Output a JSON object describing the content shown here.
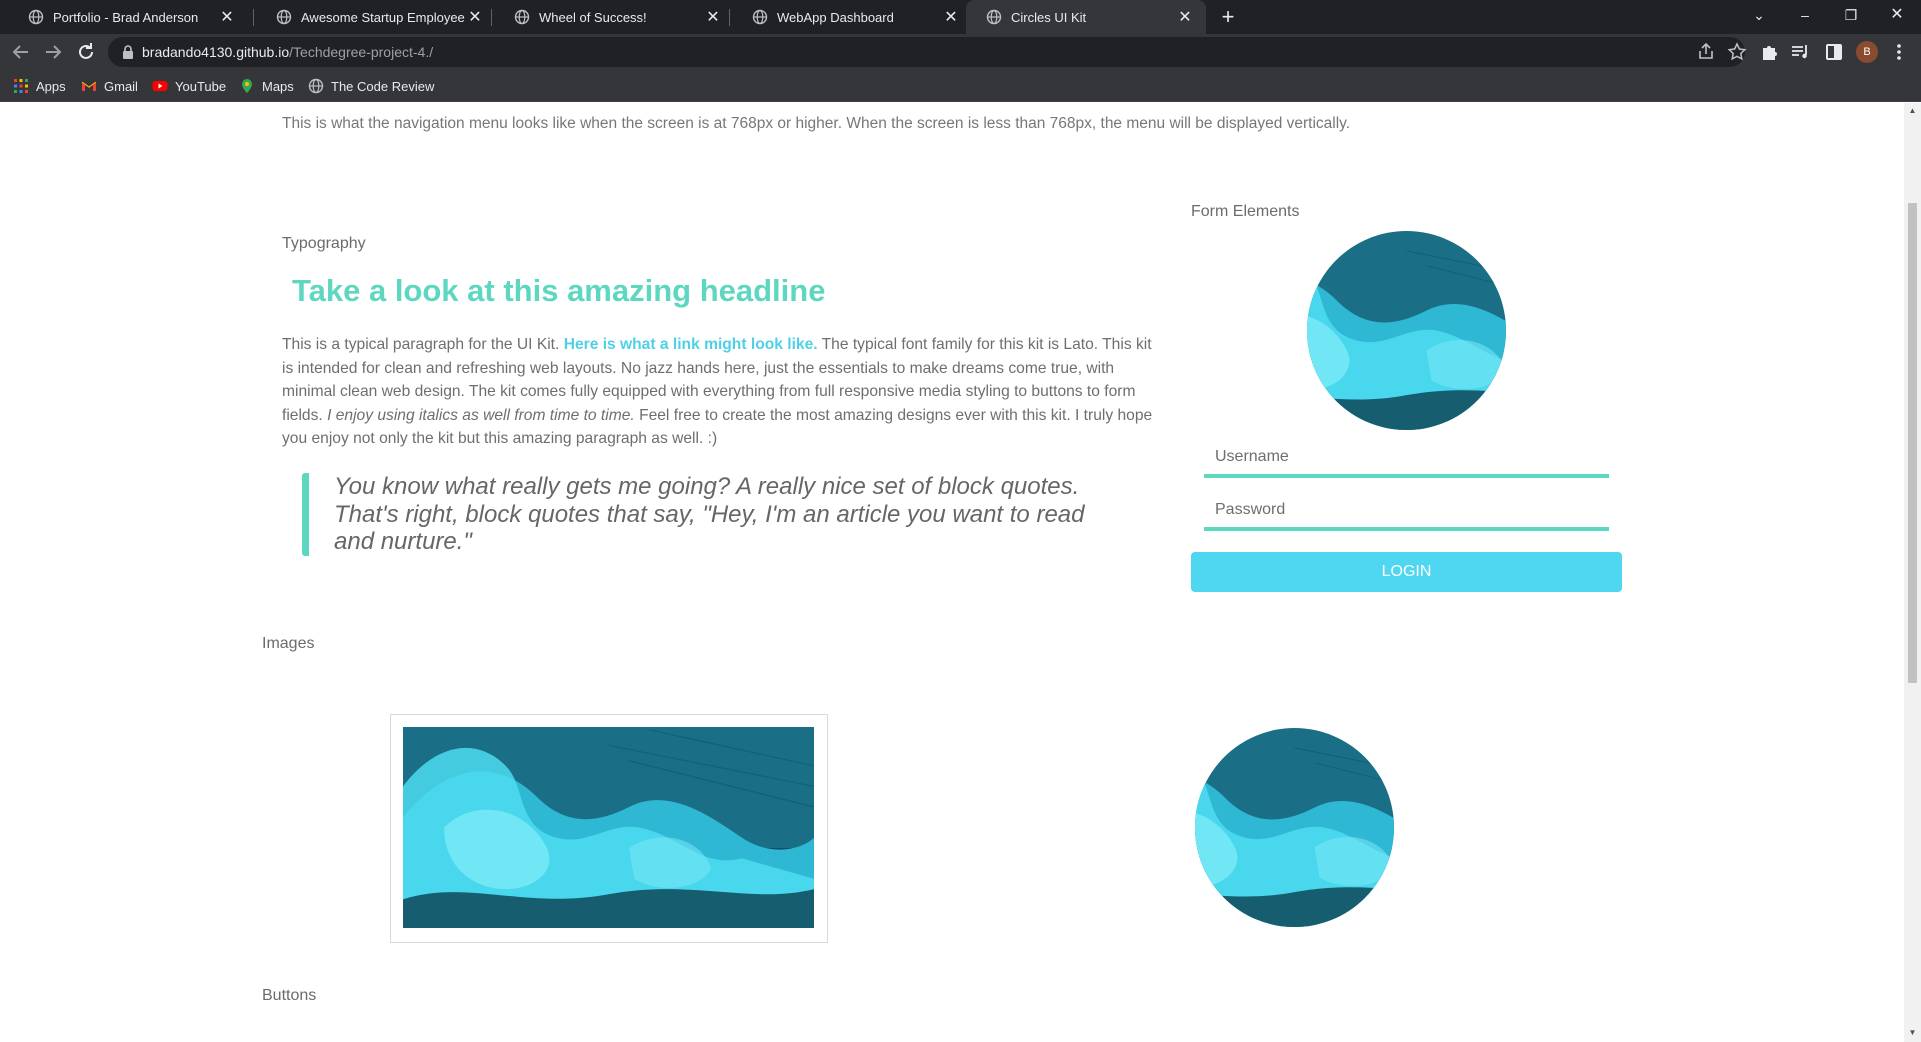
{
  "browser": {
    "tabs": [
      {
        "title": "Portfolio - Brad Anderson",
        "active": false
      },
      {
        "title": "Awesome Startup Employee Dire",
        "active": false
      },
      {
        "title": "Wheel of Success!",
        "active": false
      },
      {
        "title": "WebApp Dashboard",
        "active": false
      },
      {
        "title": "Circles UI Kit",
        "active": true
      }
    ],
    "url_host": "bradando4130.github.io",
    "url_path": "/Techdegree-project-4./",
    "profile_initial": "B",
    "bookmarks": [
      "Apps",
      "Gmail",
      "YouTube",
      "Maps",
      "The Code Review"
    ]
  },
  "page": {
    "nav_note": "This is what the navigation menu looks like when the screen is at 768px or higher. When the screen is less than 768px, the menu will be displayed vertically.",
    "typography": {
      "label": "Typography",
      "headline": "Take a look at this amazing headline",
      "para_part1": "This is a typical paragraph for the UI Kit. ",
      "para_link": "Here is what a link might look like.",
      "para_part2": " The typical font family for this kit is Lato. This kit is intended for clean and refreshing web layouts. No jazz hands here, just the essentials to make dreams come true, with minimal clean web design. The kit comes fully equipped with everything from full responsive media styling to buttons to form fields. ",
      "para_italic": "I enjoy using italics as well from time to time.",
      "para_part3": " Feel free to create the most amazing designs ever with this kit. I truly hope you enjoy not only the kit but this amazing paragraph as well. :)",
      "blockquote": "You know what really gets me going? A really nice set of block quotes. That's right, block quotes that say, \"Hey, I'm an article you want to read and nurture.\""
    },
    "form": {
      "label": "Form Elements",
      "username_placeholder": "Username",
      "password_placeholder": "Password",
      "login_label": "LOGIN"
    },
    "images": {
      "label": "Images"
    },
    "buttons": {
      "label": "Buttons"
    }
  },
  "colors": {
    "accent_teal": "#5dd7bf",
    "accent_cyan": "#4fd7f2",
    "link": "#4fd0e8",
    "chrome_dark": "#202124",
    "chrome_mid": "#35363a"
  },
  "icons": [
    "globe-icon",
    "close-icon",
    "plus-icon",
    "back-arrow-icon",
    "forward-arrow-icon",
    "reload-icon",
    "lock-icon",
    "share-icon",
    "star-icon",
    "puzzle-icon",
    "media-icon",
    "sidepanel-icon",
    "menu-dots-icon",
    "apps-grid-icon",
    "gmail-icon",
    "youtube-icon",
    "maps-pin-icon",
    "chevron-down-icon",
    "minimize-icon",
    "restore-icon"
  ]
}
